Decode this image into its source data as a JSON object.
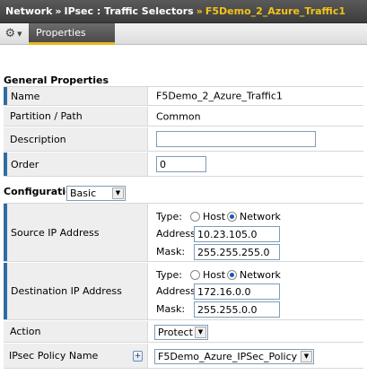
{
  "breadcrumb": {
    "items": [
      "Network",
      "IPsec : Traffic Selectors"
    ],
    "separator": "»",
    "current": "F5Demo_2_Azure_Traffic1"
  },
  "tabs": {
    "active_label": "Properties",
    "menu_icon": "gear-icon"
  },
  "general": {
    "title": "General Properties",
    "name_label": "Name",
    "name_value": "F5Demo_2_Azure_Traffic1",
    "partition_label": "Partition / Path",
    "partition_value": "Common",
    "description_label": "Description",
    "description_value": "",
    "order_label": "Order",
    "order_value": "0"
  },
  "configuration": {
    "label": "Configuration:",
    "mode": "Basic",
    "source": {
      "label": "Source IP Address",
      "type_label": "Type:",
      "host_label": "Host",
      "network_label": "Network",
      "selected": "Network",
      "address_label": "Address:",
      "address_value": "10.23.105.0",
      "mask_label": "Mask:",
      "mask_value": "255.255.255.0"
    },
    "destination": {
      "label": "Destination IP Address",
      "type_label": "Type:",
      "host_label": "Host",
      "network_label": "Network",
      "selected": "Network",
      "address_label": "Address:",
      "address_value": "172.16.0.0",
      "mask_label": "Mask:",
      "mask_value": "255.255.0.0"
    },
    "action_label": "Action",
    "action_value": "Protect",
    "policy_label": "IPsec Policy Name",
    "policy_add": "+",
    "policy_value": "F5Demo_Azure_IPSec_Policy"
  },
  "colors": {
    "accent": "#e8b81a",
    "required_bar": "#2f6ea3",
    "topbar": "#4a4a4a"
  }
}
